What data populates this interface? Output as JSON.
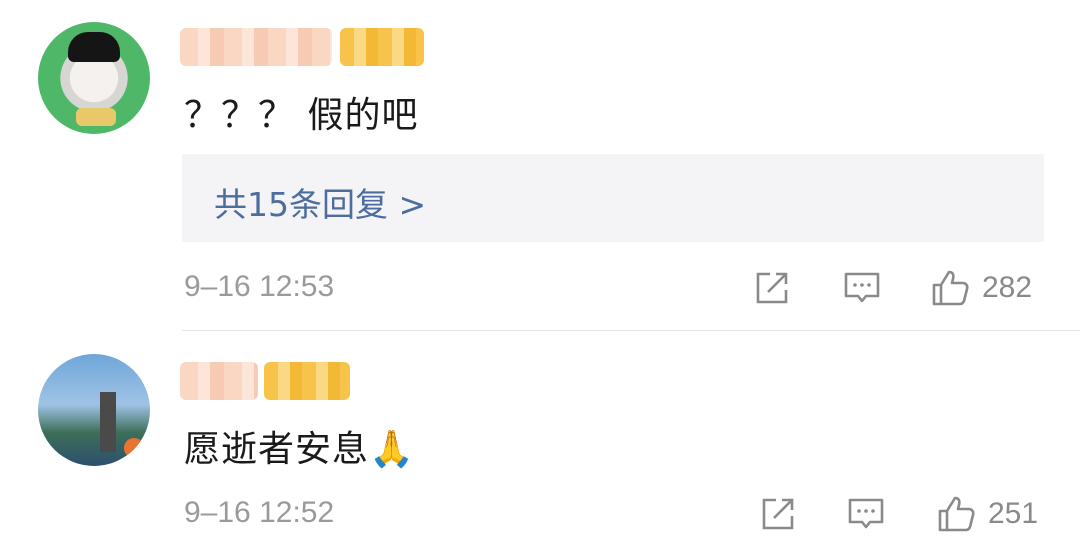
{
  "comments": [
    {
      "text": "？？？ 假的吧",
      "reply_summary": "共15条回复 >",
      "timestamp": "9–16 12:53",
      "likes": "282",
      "avatar_icon": "avatar-cartoon-icon"
    },
    {
      "text": "愿逝者安息🙏",
      "timestamp": "9–16 12:52",
      "likes": "251",
      "avatar_icon": "avatar-landscape-icon"
    }
  ],
  "colors": {
    "text": "#1a1a1a",
    "link": "#4c6d9e",
    "meta": "#9a9a9a",
    "reply_bg": "#f4f4f6",
    "divider": "#e6e6e6"
  },
  "icons": {
    "repost": "repost-icon",
    "comment": "comment-icon",
    "like": "thumbs-up-icon"
  }
}
